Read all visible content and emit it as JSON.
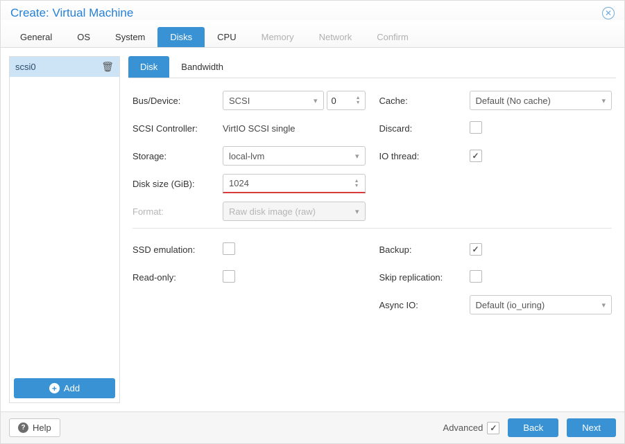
{
  "title": "Create: Virtual Machine",
  "tabs": {
    "general": "General",
    "os": "OS",
    "system": "System",
    "disks": "Disks",
    "cpu": "CPU",
    "memory": "Memory",
    "network": "Network",
    "confirm": "Confirm"
  },
  "side": {
    "item0": "scsi0",
    "add": "Add"
  },
  "subtabs": {
    "disk": "Disk",
    "bandwidth": "Bandwidth"
  },
  "left": {
    "bus_label": "Bus/Device:",
    "bus_value": "SCSI",
    "bus_index": "0",
    "ctrl_label": "SCSI Controller:",
    "ctrl_value": "VirtIO SCSI single",
    "storage_label": "Storage:",
    "storage_value": "local-lvm",
    "size_label": "Disk size (GiB):",
    "size_value": "1024",
    "format_label": "Format:",
    "format_value": "Raw disk image (raw)",
    "ssd_label": "SSD emulation:",
    "ro_label": "Read-only:"
  },
  "right": {
    "cache_label": "Cache:",
    "cache_value": "Default (No cache)",
    "discard_label": "Discard:",
    "iothread_label": "IO thread:",
    "backup_label": "Backup:",
    "skiprep_label": "Skip replication:",
    "asyncio_label": "Async IO:",
    "asyncio_value": "Default (io_uring)"
  },
  "footer": {
    "help": "Help",
    "advanced": "Advanced",
    "back": "Back",
    "next": "Next"
  }
}
